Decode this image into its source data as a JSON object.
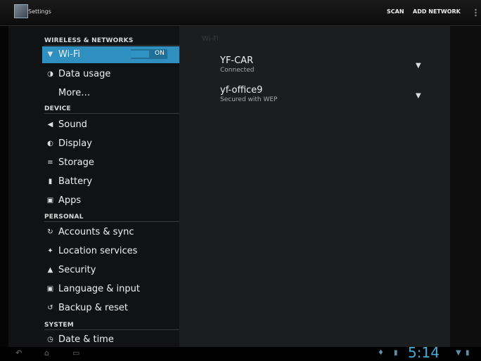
{
  "actionbar": {
    "title": "Settings",
    "scan": "SCAN",
    "add_network": "ADD NETWORK"
  },
  "sidebar": {
    "categories": {
      "wireless": "WIRELESS & NETWORKS",
      "device": "DEVICE",
      "personal": "PERSONAL",
      "system": "SYSTEM"
    },
    "items": {
      "wifi": "Wi-Fi",
      "wifi_toggle": "ON",
      "data_usage": "Data usage",
      "more": "More…",
      "sound": "Sound",
      "display": "Display",
      "storage": "Storage",
      "battery": "Battery",
      "apps": "Apps",
      "accounts": "Accounts & sync",
      "location": "Location services",
      "security": "Security",
      "language": "Language & input",
      "backup": "Backup & reset",
      "datetime": "Date & time"
    }
  },
  "networks": {
    "pane_title": "Wi-Fi",
    "list": [
      {
        "ssid": "YF-CAR",
        "status": "Connected"
      },
      {
        "ssid": "yf-office9",
        "status": "Secured with WEP"
      }
    ]
  },
  "system_bar": {
    "time": "5:14"
  },
  "icons": {
    "wifi": "wifi-icon",
    "data_usage": "data-usage-icon",
    "sound": "speaker-icon",
    "display": "brightness-icon",
    "storage": "storage-icon",
    "battery": "battery-icon",
    "apps": "apps-icon",
    "accounts": "sync-icon",
    "location": "location-icon",
    "security": "lock-icon",
    "language": "keyboard-icon",
    "backup": "backup-icon",
    "datetime": "clock-icon"
  },
  "colors": {
    "accent": "#2f8fbf",
    "clock": "#4aa9d6"
  }
}
